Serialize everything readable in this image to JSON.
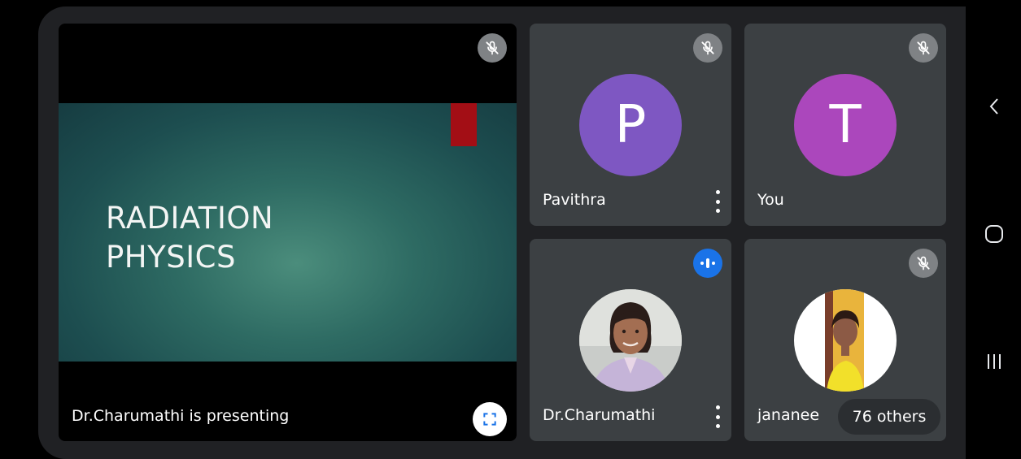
{
  "presentation": {
    "slide_title_lines": [
      "RADIATION",
      "PHYSICS"
    ],
    "presenting_label": "Dr.Charumathi is presenting"
  },
  "participants": [
    {
      "name": "Pavithra",
      "initial": "P",
      "avatar_color": "#7e57c2",
      "status": "muted"
    },
    {
      "name": "You",
      "initial": "T",
      "avatar_color": "#ab47bc",
      "status": "muted"
    },
    {
      "name": "Dr.Charumathi",
      "status": "speaking"
    },
    {
      "name": "jananee",
      "status": "muted"
    }
  ],
  "others_label": "76 others",
  "colors": {
    "tile_bg": "#3c4043",
    "speaking_blue": "#1a73e8",
    "muted_gray": "#7f8285",
    "slide_accent": "#a30e15"
  },
  "icons": [
    "mic-off-icon",
    "audio-wave-icon",
    "more-vert-icon",
    "fullscreen-icon",
    "back-nav-icon",
    "home-nav-icon",
    "recents-nav-icon"
  ]
}
